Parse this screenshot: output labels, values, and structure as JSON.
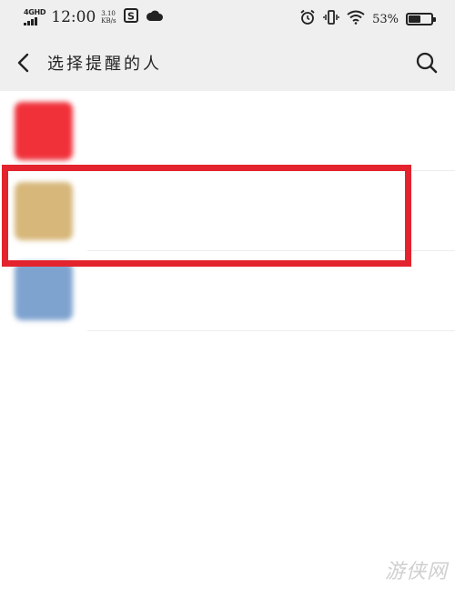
{
  "status_bar": {
    "network_type": "4GHD",
    "time": "12:00",
    "speed_value": "3.10",
    "speed_unit": "KB/s",
    "battery_percent": "53%",
    "battery_level": 0.53,
    "icons": [
      "signal-icon",
      "app-notification-icon",
      "weather-cloud-icon",
      "alarm-icon",
      "vibrate-icon",
      "wifi-icon",
      "battery-icon"
    ]
  },
  "header": {
    "title": "选择提醒的人",
    "back_icon": "chevron-left-icon",
    "search_icon": "search-icon"
  },
  "contacts": [
    {
      "avatar_color": "#f0313a",
      "name": ""
    },
    {
      "avatar_color": "#d7b77a",
      "name": ""
    },
    {
      "avatar_color": "#7fa3cf",
      "name": ""
    }
  ],
  "highlight": {
    "color": "#e3232d"
  },
  "watermark": "游侠网"
}
